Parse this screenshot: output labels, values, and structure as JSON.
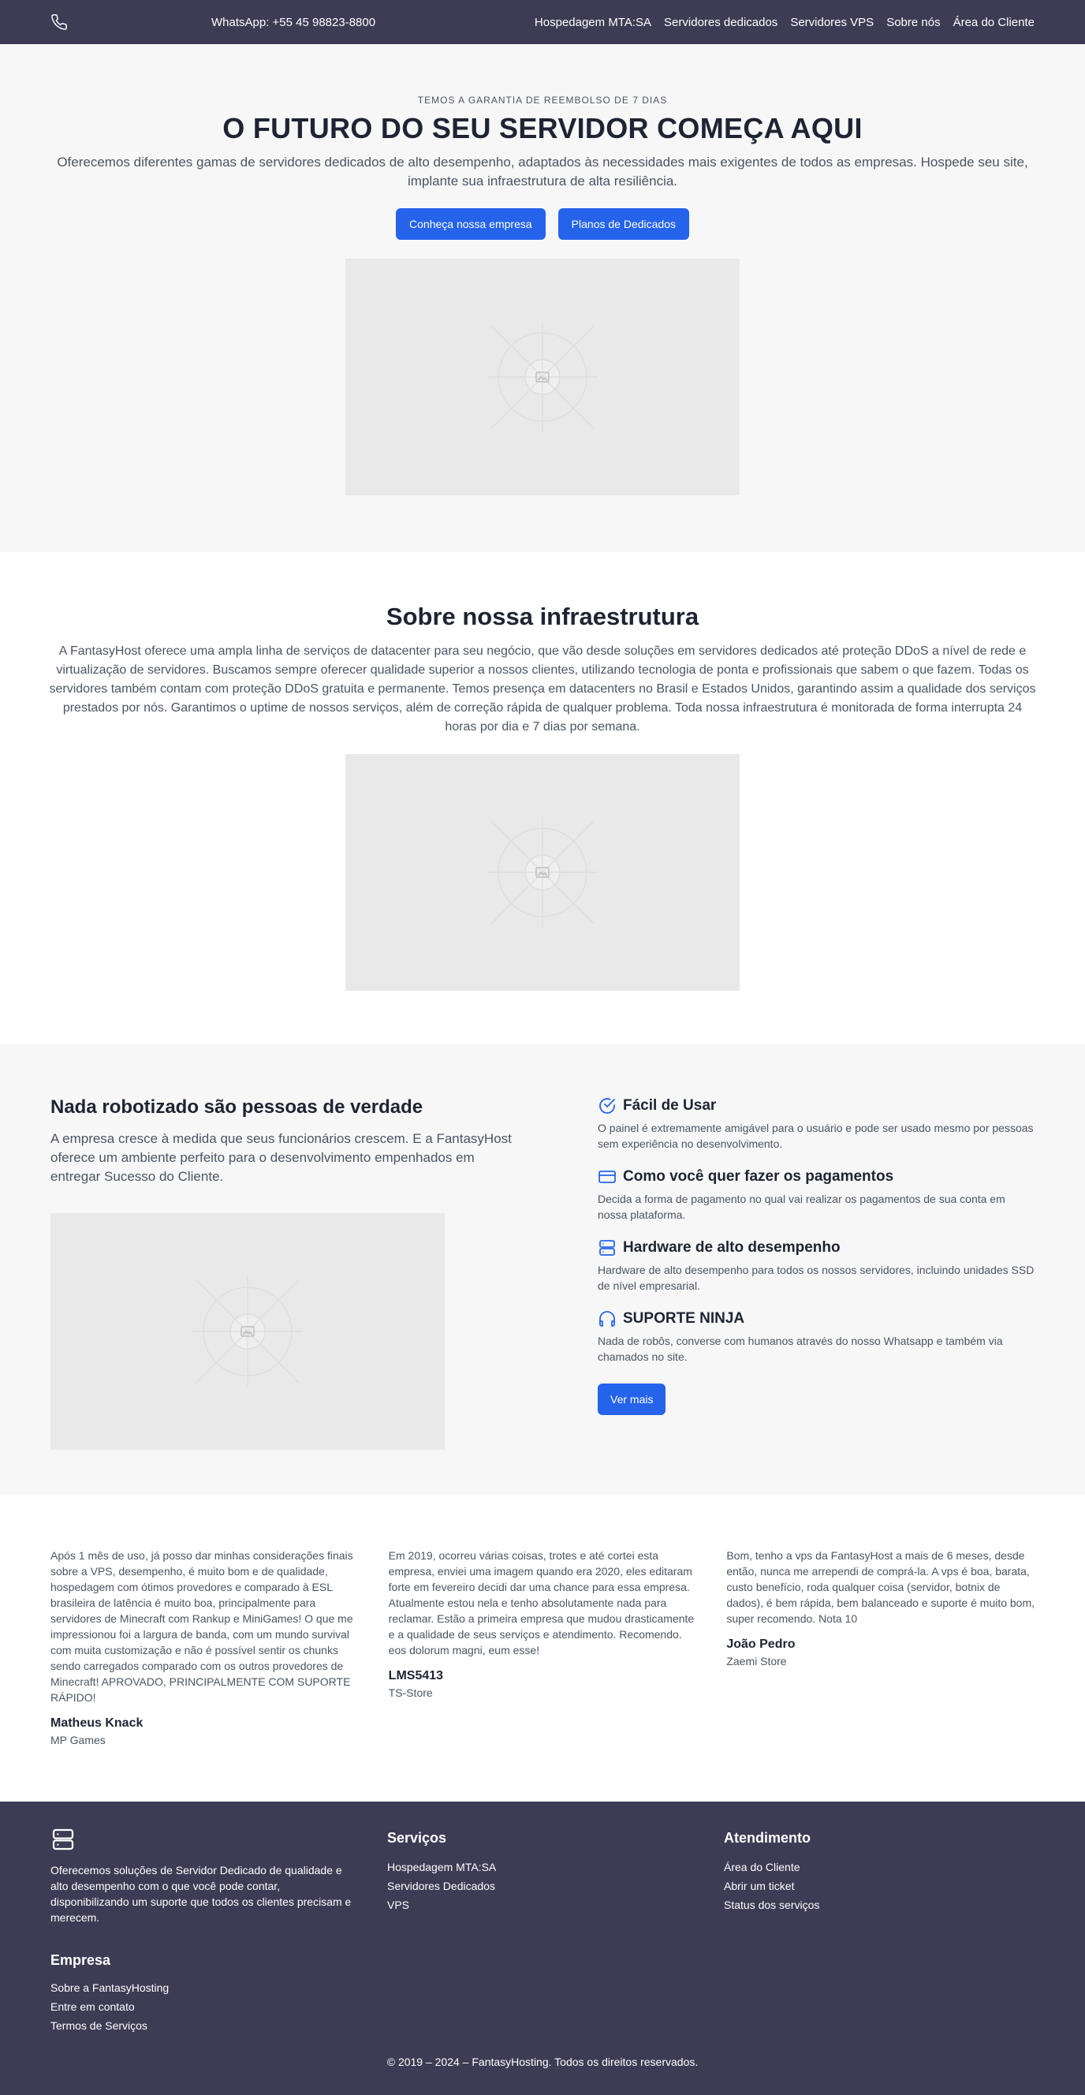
{
  "nav": {
    "phone_icon": "phone-icon",
    "whatsapp": "WhatsApp: +55 45 98823-8800",
    "links": [
      "Hospedagem MTA:SA",
      "Servidores dedicados",
      "Servidores VPS",
      "Sobre nós",
      "Área do Cliente"
    ]
  },
  "hero": {
    "eyebrow": "TEMOS A GARANTIA DE REEMBOLSO DE 7 DIAS",
    "title": "O FUTURO DO SEU SERVIDOR COMEÇA AQUI",
    "lead": "Oferecemos diferentes gamas de servidores dedicados de alto desempenho, adaptados às necessidades mais exigentes de todos as empresas. Hospede seu site, implante sua infraestrutura de alta resiliência.",
    "primary_button": "Conheça nossa empresa",
    "secondary_button": "Planos de Dedicados"
  },
  "about": {
    "title": "Sobre nossa infraestrutura",
    "text": "A FantasyHost oferece uma ampla linha de serviços de datacenter para seu negócio, que vão desde soluções em servidores dedicados até proteção DDoS a nível de rede e virtualização de servidores. Buscamos sempre oferecer qualidade superior a nossos clientes, utilizando tecnologia de ponta e profissionais que sabem o que fazem. Todas os servidores também contam com proteção DDoS gratuita e permanente. Temos presença em datacenters no Brasil e Estados Unidos, garantindo assim a qualidade dos serviços prestados por nós. Garantimos o uptime de nossos serviços, além de correção rápida de qualquer problema. Toda nossa infraestrutura é monitorada de forma interrupta 24 horas por dia e 7 dias por semana."
  },
  "features": {
    "title": "Nada robotizado são pessoas de verdade",
    "text": "A empresa cresce à medida que seus funcionários crescem. E a FantasyHost oferece um ambiente perfeito para o desenvolvimento empenhados em entregar Sucesso do Cliente.",
    "items": [
      {
        "icon": "check-badge-icon",
        "title": "Fácil de Usar",
        "text": "O painel é extremamente amigável para o usuário e pode ser usado mesmo por pessoas sem experiência no desenvolvimento."
      },
      {
        "icon": "credit-card-icon",
        "title": "Como você quer fazer os pagamentos",
        "text": "Decida a forma de pagamento no qual vai realizar os pagamentos de sua conta em nossa plataforma."
      },
      {
        "icon": "server-icon",
        "title": "Hardware de alto desempenho",
        "text": "Hardware de alto desempenho para todos os nossos servidores, incluindo unidades SSD de nível empresarial."
      },
      {
        "icon": "headphones-icon",
        "title": "SUPORTE NINJA",
        "text": "Nada de robôs, converse com humanos através do nosso Whatsapp e também via chamados no site."
      }
    ],
    "button": "Ver mais",
    "accent": "#2563eb"
  },
  "testimonials": [
    {
      "text": "Após 1 mês de uso, já posso dar minhas considerações finais sobre a VPS, desempenho, é muito bom e de qualidade, hospedagem com ótimos provedores e comparado à ESL brasileira de latência é muito boa, principalmente para servidores de Minecraft com Rankup e MiniGames! O que me impressionou foi a largura de banda, com um mundo survival com muita customização e não é possível sentir os chunks sendo carregados comparado com os outros provedores de Minecraft! APROVADO, PRINCIPALMENTE COM SUPORTE RÁPIDO!",
      "name": "Matheus Knack",
      "company": "MP Games"
    },
    {
      "text": "Em 2019, ocorreu várias coisas, trotes e até cortei esta empresa, enviei uma imagem quando era 2020, eles editaram forte em fevereiro decidi dar uma chance para essa empresa. Atualmente estou nela e tenho absolutamente nada para reclamar. Estão a primeira empresa que mudou drasticamente e a qualidade de seus serviços e atendimento. Recomendo. eos dolorum magni, eum esse!",
      "name": "LMS5413",
      "company": "TS-Store"
    },
    {
      "text": "Bom, tenho a vps da FantasyHost a mais de 6 meses, desde então, nunca me arrependi de comprá-la. A vps é boa, barata, custo benefício, roda qualquer coisa (servidor, botnix de dados), é bem rápida, bem balanceado e suporte é muito bom, super recomendo. Nota 10",
      "name": "João Pedro",
      "company": "Zaemi Store"
    }
  ],
  "footer": {
    "logo_icon": "server-icon",
    "description": "Oferecemos soluções de Servidor Dedicado de qualidade e alto desempenho com o que você pode contar, disponibilizando um suporte que todos os clientes precisam e merecem.",
    "services": {
      "title": "Serviços",
      "links": [
        "Hospedagem MTA:SA",
        "Servidores Dedicados",
        "VPS"
      ]
    },
    "support": {
      "title": "Atendimento",
      "links": [
        "Área do Cliente",
        "Abrir um ticket",
        "Status dos serviços"
      ]
    },
    "company": {
      "title": "Empresa",
      "links": [
        "Sobre a FantasyHosting",
        "Entre em contato",
        "Termos de Serviços"
      ]
    },
    "copyright": "© 2019 – 2024 – FantasyHosting. Todos os direitos reservados.",
    "background": "#3e3b54"
  }
}
